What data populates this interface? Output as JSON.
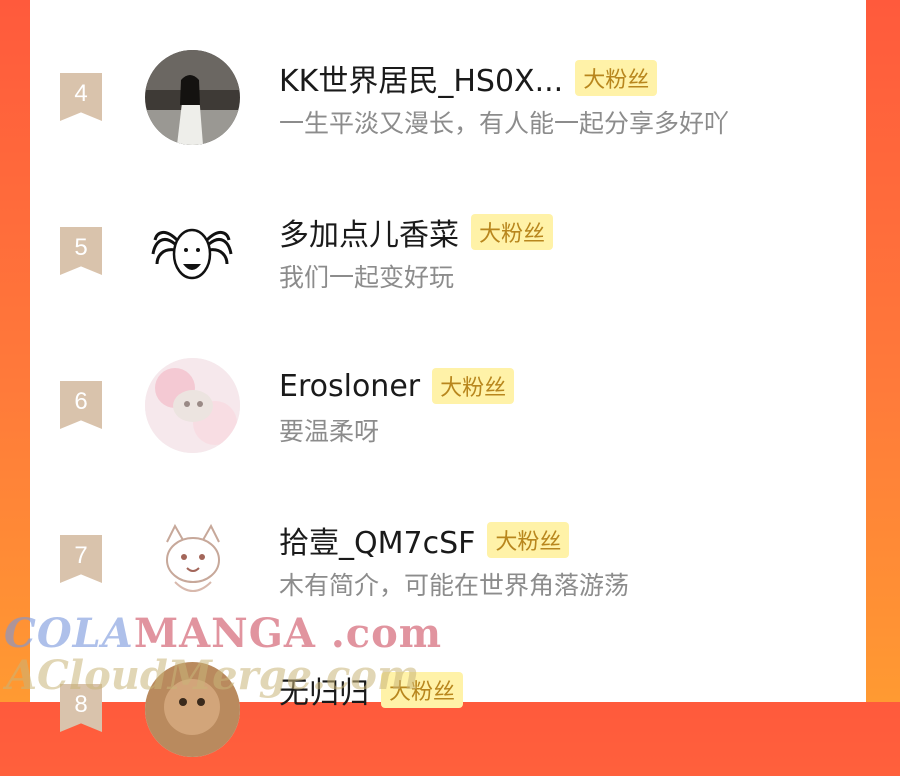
{
  "rows": [
    {
      "rank": "4",
      "name": "KK世界居民_HS0X...",
      "badge": "大粉丝",
      "bio": "一生平淡又漫长，有人能一起分享多好吖"
    },
    {
      "rank": "5",
      "name": "多加点儿香菜",
      "badge": "大粉丝",
      "bio": "我们一起变好玩"
    },
    {
      "rank": "6",
      "name": "Erosloner",
      "badge": "大粉丝",
      "bio": "要温柔呀"
    },
    {
      "rank": "7",
      "name": "拾壹_QM7cSF",
      "badge": "大粉丝",
      "bio": "木有简介，可能在世界角落游荡"
    },
    {
      "rank": "8",
      "name": "无归归",
      "badge": "大粉丝",
      "bio": ""
    }
  ],
  "watermark": {
    "line1_a": "COLA",
    "line1_b": "MANGA",
    "line1_c": " .com",
    "line2": "ACloudMerge.com"
  },
  "colors": {
    "badge_bg": "#fff2a8",
    "badge_text": "#b8861d",
    "rank_bg": "#d9c3ac"
  }
}
